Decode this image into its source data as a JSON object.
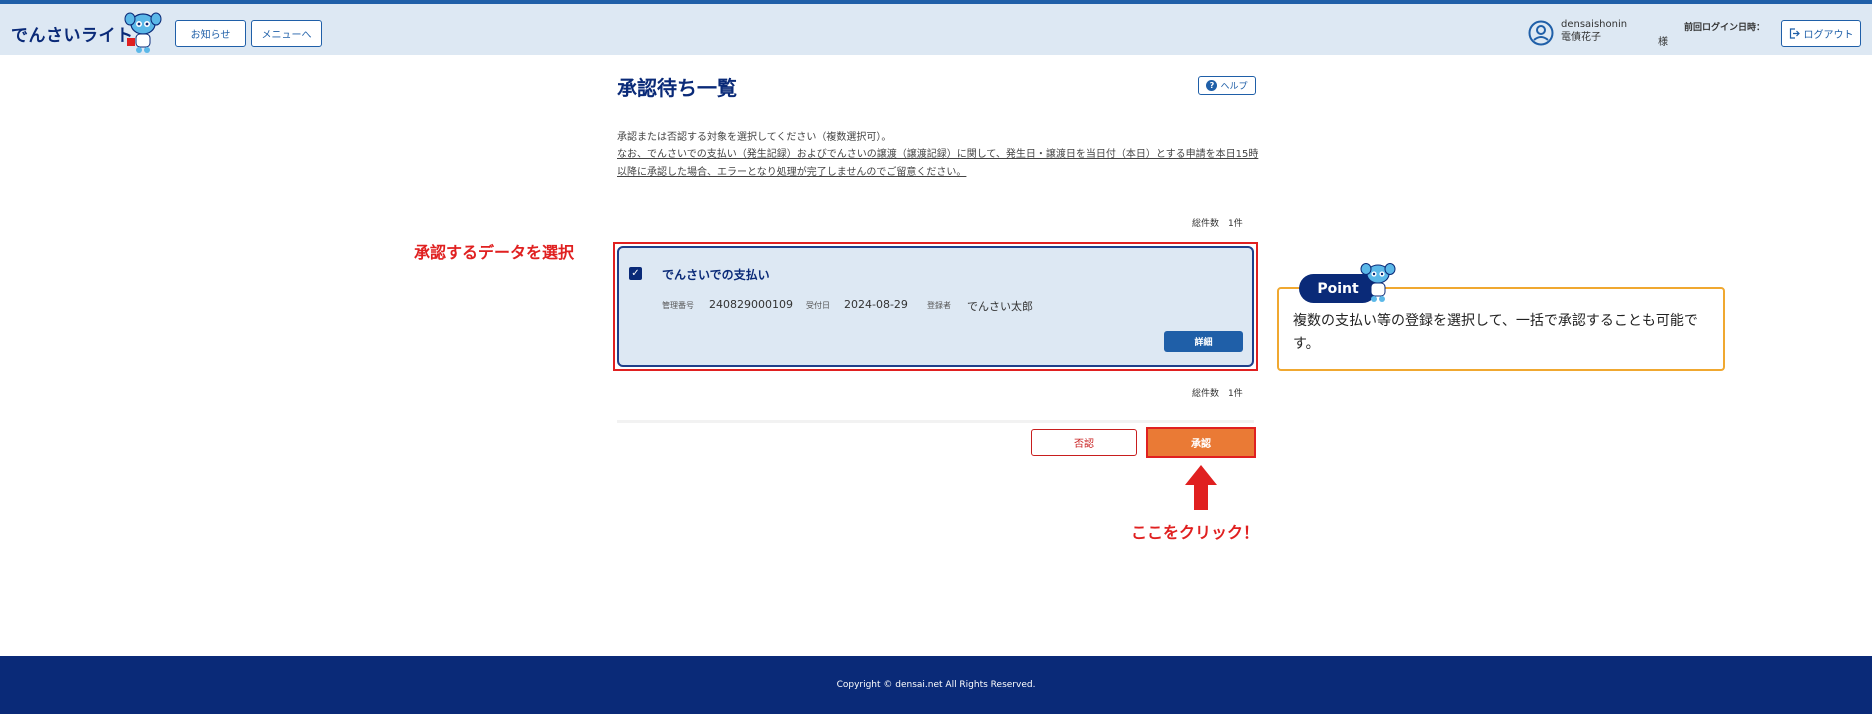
{
  "header": {
    "brand": "でんさいライト",
    "notice_button": "お知らせ",
    "menu_button": "メニューへ",
    "user_id": "densaishonin",
    "user_name": "電債花子",
    "honorific": "様",
    "last_login_label": "前回ログイン日時：",
    "logout_button": "ログアウト"
  },
  "main": {
    "title": "承認待ち一覧",
    "help_button": "ヘルプ",
    "note_line1": "承認または否認する対象を選択してください（複数選択可）。",
    "note_line2": "なお、でんさいでの支払い（発生記録）およびでんさいの譲渡（譲渡記録）に関して、発生日・譲渡日を当日付（本日）とする申請を本日15時以降に承認した場合、エラーとなり処理が完了しませんのでご留意ください。",
    "total_count_top": "総件数　1件",
    "total_count_bottom": "総件数　1件",
    "card": {
      "title": "でんさいでの支払い",
      "mgmt_no_label": "管理番号",
      "mgmt_no": "240829000109",
      "received_label": "受付日",
      "received_date": "2024-08-29",
      "registrant_label": "登録者",
      "registrant": "でんさい太郎",
      "detail_button": "詳細"
    },
    "reject_button": "否認",
    "approve_button": "承認"
  },
  "annotations": {
    "select_label": "承認するデータを選択",
    "click_label": "ここをクリック！",
    "point_badge": "Point",
    "point_text": "複数の支払い等の登録を選択して、一括で承認することも可能です。"
  },
  "footer": {
    "copyright": "Copyright © densai.net All Rights Reserved."
  },
  "colors": {
    "navy": "#0a2a78",
    "blue": "#1f5fa8",
    "light_blue_bg": "#dde8f3",
    "annotation_red": "#e02020",
    "approve_orange": "#ea7a35",
    "point_border": "#f0a830"
  },
  "icons": {
    "user": "user-circle-icon",
    "logout": "logout-icon",
    "help": "question-circle-icon",
    "checkbox": "checkbox-checked-icon",
    "arrow": "arrow-up-icon",
    "mascot": "mascot-icon"
  }
}
